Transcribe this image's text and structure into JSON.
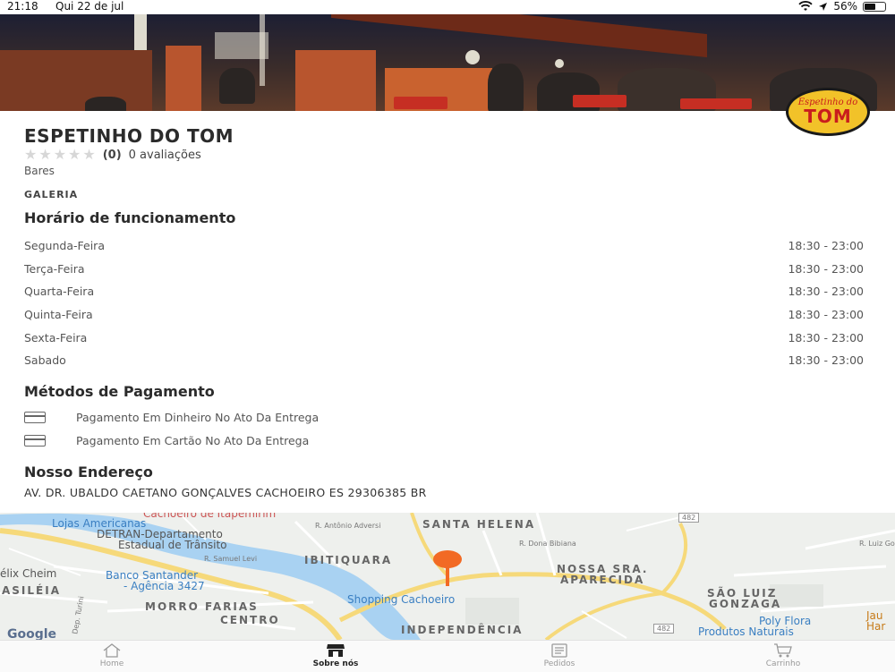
{
  "status_bar": {
    "time": "21:18",
    "date": "Qui 22 de jul",
    "battery": "56%",
    "battery_level": 0.56
  },
  "restaurant": {
    "name": "ESPETINHO DO TOM",
    "rating_count": "(0)",
    "rating_text": "0 avaliações",
    "stars": 0,
    "category": "Bares",
    "gallery_label": "GALERIA",
    "logo_line1": "Espetinho do",
    "logo_line2": "TOM"
  },
  "hours": {
    "title": "Horário de funcionamento",
    "rows": [
      {
        "day": "Segunda-Feira",
        "time": "18:30 - 23:00"
      },
      {
        "day": "Terça-Feira",
        "time": "18:30 - 23:00"
      },
      {
        "day": "Quarta-Feira",
        "time": "18:30 - 23:00"
      },
      {
        "day": "Quinta-Feira",
        "time": "18:30 - 23:00"
      },
      {
        "day": "Sexta-Feira",
        "time": "18:30 - 23:00"
      },
      {
        "day": "Sabado",
        "time": "18:30 - 23:00"
      }
    ]
  },
  "payment": {
    "title": "Métodos de Pagamento",
    "methods": [
      {
        "label": "Pagamento Em Dinheiro No Ato Da Entrega",
        "icon": "credit-card-icon"
      },
      {
        "label": "Pagamento Em Cartão No Ato Da Entrega",
        "icon": "credit-card-icon"
      }
    ]
  },
  "address": {
    "title": "Nosso Endereço",
    "text": "AV. DR. UBALDO CAETANO GONÇALVES CACHOEIRO ES 29306385 BR"
  },
  "map": {
    "labels": {
      "lojas": "Lojas Americanas",
      "cachoeiro": "Cachoeiro de Itapemirim",
      "detran1": "DETRAN-Departamento",
      "detran2": "Estadual de Trânsito",
      "antonio": "R. Antônio Adversi",
      "santa_helena": "SANTA HELENA",
      "shield_top": "482",
      "shield_bottom": "482",
      "dona_bibiana": "R. Dona Bibiana",
      "luiz_go": "R. Luiz Go",
      "samuel": "R. Samuel Levi",
      "ibitiquara": "IBITIQUARA",
      "cheim": "élix Cheim",
      "santander1": "Banco Santander",
      "santander2": "- Agência 3427",
      "nossa1": "NOSSA SRA.",
      "nossa2": "APARECIDA",
      "basileia": "ASILÉIA",
      "shopping": "Shopping Cachoeiro",
      "morro": "MORRO FARIAS",
      "centro": "CENTRO",
      "sao1": "SÃO LUIZ",
      "sao2": "GONZAGA",
      "poly1": "Poly Flora",
      "poly2": "Produtos Naturais",
      "jau": "Jau",
      "har": "Har",
      "independencia": "INDEPENDÊNCIA",
      "google": "Google",
      "dep_turini": "Dep. Turini"
    }
  },
  "tabbar": {
    "tabs": [
      {
        "label": "Home",
        "icon": "home-icon"
      },
      {
        "label": "Sobre nós",
        "icon": "store-icon"
      },
      {
        "label": "Pedidos",
        "icon": "orders-icon"
      },
      {
        "label": "Carrinho",
        "icon": "cart-icon"
      }
    ],
    "active_tab": "Sobre nós"
  },
  "colors": {
    "pin": "#f26a24",
    "road_yellow": "#f6d97a",
    "river": "#a9d2f2",
    "active_tab": "#222222"
  }
}
